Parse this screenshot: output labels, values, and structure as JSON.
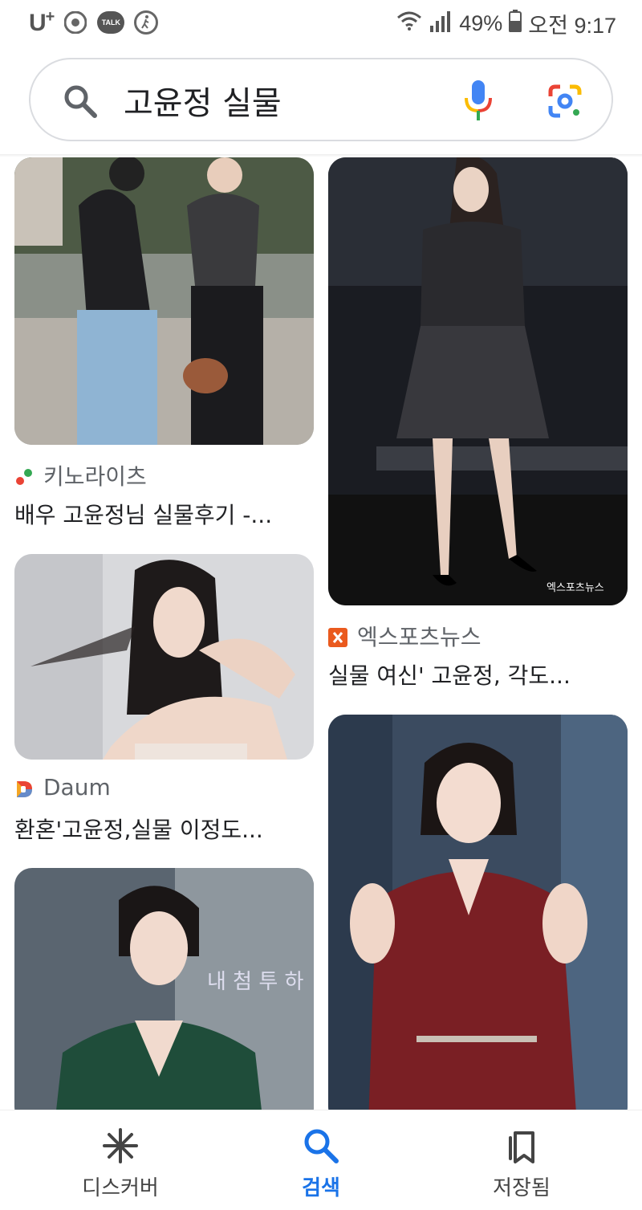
{
  "status_bar": {
    "carrier": "U",
    "carrier_sup": "+",
    "talk_label": "TALK",
    "battery": "49%",
    "time": "오전 9:17"
  },
  "search": {
    "query": "고윤정 실물"
  },
  "results": [
    {
      "source": "키노라이츠",
      "title": "배우 고윤정님 실물후기 -...",
      "favicon": "kinolights-dots-icon"
    },
    {
      "source": "엑스포츠뉴스",
      "title": "실물 여신' 고윤정, 각도...",
      "favicon": "xports-x-icon",
      "watermark": "엑스포츠뉴스"
    },
    {
      "source": "Daum",
      "title": "환혼'고윤정,실물 이정도...",
      "favicon": "daum-d-icon"
    },
    {
      "source": "",
      "title": "",
      "favicon": ""
    },
    {
      "source": "",
      "title": "",
      "favicon": ""
    }
  ],
  "image_texts": {
    "poster_text": "내 첨 투 하"
  },
  "bottom_nav": {
    "discover": "디스커버",
    "search": "검색",
    "saved": "저장됨",
    "active": "search"
  },
  "colors": {
    "accent": "#1a73e8",
    "google_red": "#ea4335",
    "google_yellow": "#fbbc04",
    "google_green": "#34a853",
    "google_blue": "#4285f4"
  }
}
